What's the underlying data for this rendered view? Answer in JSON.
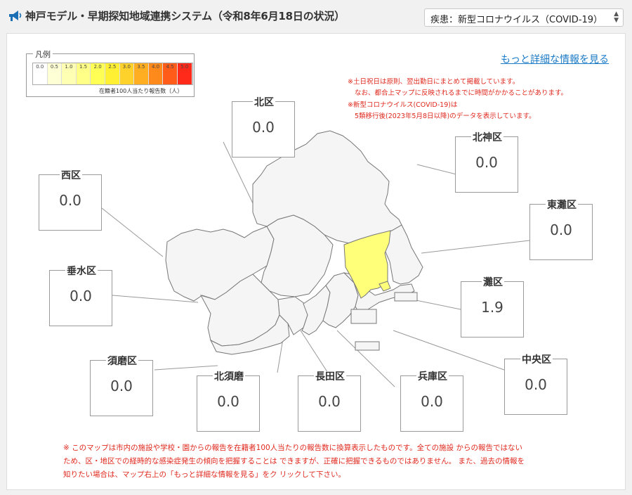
{
  "header": {
    "title": "神戸モデル・早期探知地域連携システム（令和8年6月18日の状況）",
    "icon": "megaphone-icon"
  },
  "disease_select": {
    "label": "疾患：新型コロナウイルス（COVID-19）",
    "arrow": "▲▼"
  },
  "legend": {
    "title": "凡例",
    "ticks": [
      "0.0",
      "0.5",
      "1.0",
      "1.5",
      "2.0",
      "2.5",
      "3.0",
      "3.5",
      "4.0",
      "4.5",
      "5.0"
    ],
    "colors": [
      "#ffffff",
      "#ffffd6",
      "#ffffb3",
      "#ffff88",
      "#ffff55",
      "#fff033",
      "#ffd12b",
      "#ffae22",
      "#ff8a1c",
      "#ff5c1a",
      "#ff2a1a"
    ],
    "unit": "在籍者100人当たり報告数（人）"
  },
  "detail_link": "もっと詳細な情報を見る",
  "notes": [
    "※土日祝日は原則、翌出勤日にまとめて掲載しています。",
    "なお、都合上マップに反映されるまでに時間がかかることがあります。",
    "※新型コロナウイルス(COVID-19)は",
    "5類移行後(2023年5月8日以降)のデータを表示しています。"
  ],
  "wards": {
    "kita": {
      "name": "北区",
      "value": "0.0"
    },
    "kitakobe": {
      "name": "北神区",
      "value": "0.0"
    },
    "nishi": {
      "name": "西区",
      "value": "0.0"
    },
    "higashinada": {
      "name": "東灘区",
      "value": "0.0"
    },
    "tarumi": {
      "name": "垂水区",
      "value": "0.0"
    },
    "nada": {
      "name": "灘区",
      "value": "1.9"
    },
    "suma": {
      "name": "須磨区",
      "value": "0.0"
    },
    "kitasuma": {
      "name": "北須磨",
      "value": "0.0"
    },
    "nagata": {
      "name": "長田区",
      "value": "0.0"
    },
    "hyogo": {
      "name": "兵庫区",
      "value": "0.0"
    },
    "chuo": {
      "name": "中央区",
      "value": "0.0"
    }
  },
  "footer": [
    "※ このマップは市内の施設や学校・園からの報告を在籍者100人当たりの報告数に換算表示したものです。全ての施設 からの報告ではない",
    "ため、区・地区での経時的な感染症発生の傾向を把握することは できますが、正確に把握できるものではありません。 また、過去の情報を",
    "知りたい場合は、マップ右上の「もっと詳細な情報を見る」をク リックして下さい。"
  ],
  "colors": {
    "note_red": "#e0281e",
    "link_blue": "#1a7ac6",
    "highlight_yellow": "#ffff7a",
    "map_fill": "#f5f5f5"
  }
}
